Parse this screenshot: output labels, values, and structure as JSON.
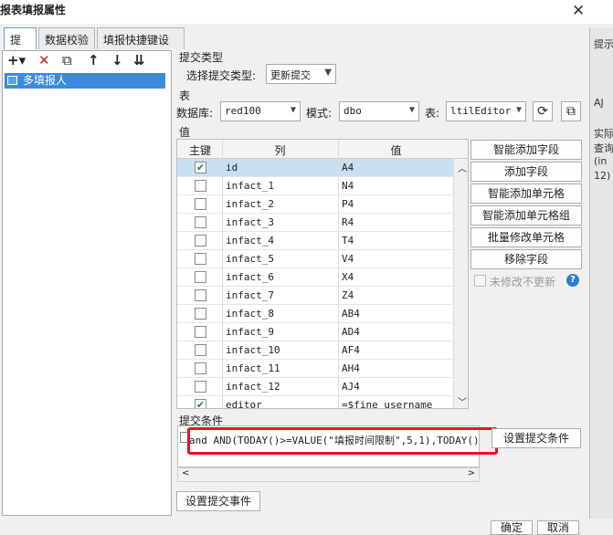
{
  "window": {
    "title": "报表填报属性",
    "close_glyph": "✕"
  },
  "tabs": [
    "提交",
    "数据校验",
    "填报快捷键设置"
  ],
  "toolbar": {
    "add": "+▾",
    "delete": "✕",
    "copy": "⧉",
    "up": "↑",
    "down": "↓",
    "bottom": "⇊"
  },
  "tree": {
    "items": [
      "多填报人"
    ]
  },
  "submit_type": {
    "section": "提交类型",
    "label": "选择提交类型:",
    "value": "更新提交"
  },
  "table_section": {
    "section": "表",
    "db_label": "数据库:",
    "db_value": "red100",
    "schema_label": "模式:",
    "schema_value": "dbo",
    "table_label": "表:",
    "table_value": "ltilEditor"
  },
  "values": {
    "section": "值",
    "columns": [
      "主键",
      "列",
      "值"
    ],
    "rows": [
      {
        "key": true,
        "col": "id",
        "val": "A4"
      },
      {
        "key": false,
        "col": "infact_1",
        "val": "N4"
      },
      {
        "key": false,
        "col": "infact_2",
        "val": "P4"
      },
      {
        "key": false,
        "col": "infact_3",
        "val": "R4"
      },
      {
        "key": false,
        "col": "infact_4",
        "val": "T4"
      },
      {
        "key": false,
        "col": "infact_5",
        "val": "V4"
      },
      {
        "key": false,
        "col": "infact_6",
        "val": "X4"
      },
      {
        "key": false,
        "col": "infact_7",
        "val": "Z4"
      },
      {
        "key": false,
        "col": "infact_8",
        "val": "AB4"
      },
      {
        "key": false,
        "col": "infact_9",
        "val": "AD4"
      },
      {
        "key": false,
        "col": "infact_10",
        "val": "AF4"
      },
      {
        "key": false,
        "col": "infact_11",
        "val": "AH4"
      },
      {
        "key": false,
        "col": "infact_12",
        "val": "AJ4"
      },
      {
        "key": true,
        "col": "editor",
        "val": "=$fine_username"
      }
    ]
  },
  "side_buttons": [
    "智能添加字段",
    "添加字段",
    "智能添加单元格",
    "智能添加单元格组",
    "批量修改单元格",
    "移除字段"
  ],
  "unmodified": {
    "label": "未修改不更新",
    "help": "?"
  },
  "condition": {
    "section": "提交条件",
    "text": "and AND(TODAY()>=VALUE(\"填报时间限制\",5,1),TODAY()",
    "button": "设置提交条件"
  },
  "event_button": "设置提交事件",
  "footer": {
    "ok": "确定",
    "cancel": "取消"
  },
  "behind_window": {
    "lines": [
      "提示",
      "AJ",
      "实际",
      "查询",
      "(in",
      "12)"
    ]
  },
  "colors": {
    "accent": "#3d8ad8",
    "highlight": "#e8141a",
    "check": "#1f8a1f"
  }
}
